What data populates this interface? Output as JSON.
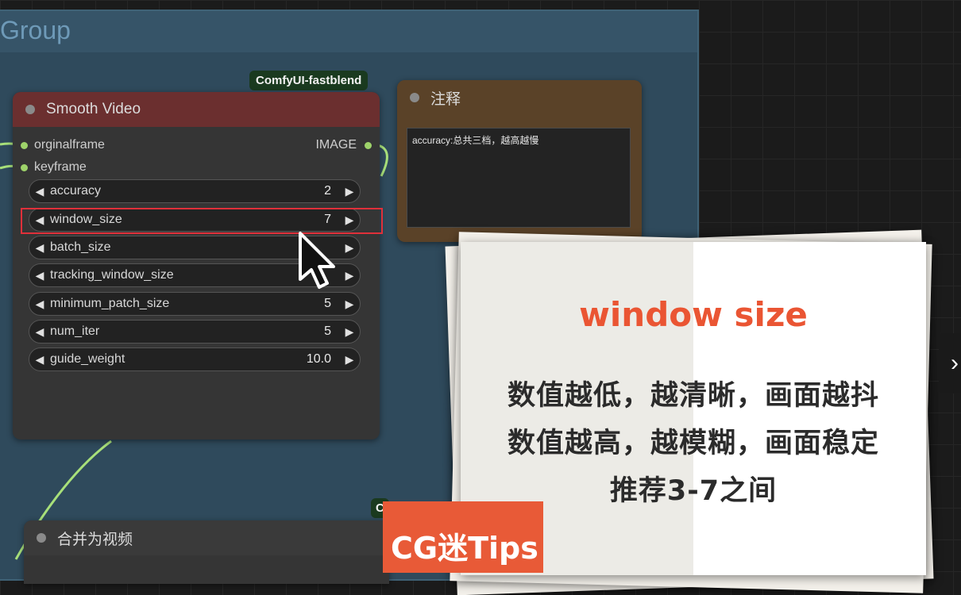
{
  "group": {
    "title": "Group"
  },
  "badges": {
    "top": "ComfyUI-fastblend",
    "bottom": "C"
  },
  "smooth_node": {
    "title": "Smooth Video",
    "inputs": [
      "orginalframe",
      "keyframe"
    ],
    "output": "IMAGE",
    "widgets": [
      {
        "label": "accuracy",
        "value": "2"
      },
      {
        "label": "window_size",
        "value": "7"
      },
      {
        "label": "batch_size",
        "value": ""
      },
      {
        "label": "tracking_window_size",
        "value": ""
      },
      {
        "label": "minimum_patch_size",
        "value": "5"
      },
      {
        "label": "num_iter",
        "value": "5"
      },
      {
        "label": "guide_weight",
        "value": "10.0"
      }
    ]
  },
  "note_node": {
    "title": "注释",
    "text": "accuracy:总共三档，越高越慢"
  },
  "merge_node": {
    "title": "合并为视频"
  },
  "card": {
    "title": "window size",
    "lines": [
      "数值越低，越清晰，画面越抖",
      "数值越高，越模糊，画面稳定",
      "推荐3-7之间"
    ]
  },
  "brand": {
    "text": "CG迷Tips"
  },
  "colors": {
    "accent": "#ea5533",
    "highlight": "#e0303a",
    "smooth_title_bar": "#6b2f2f",
    "note_title_bar": "#5a4228",
    "badge_bg": "#1a3a1f"
  },
  "icons": {
    "widget_left": "triangle-left-icon",
    "widget_right": "triangle-right-icon",
    "next": "chevron-right-icon"
  }
}
